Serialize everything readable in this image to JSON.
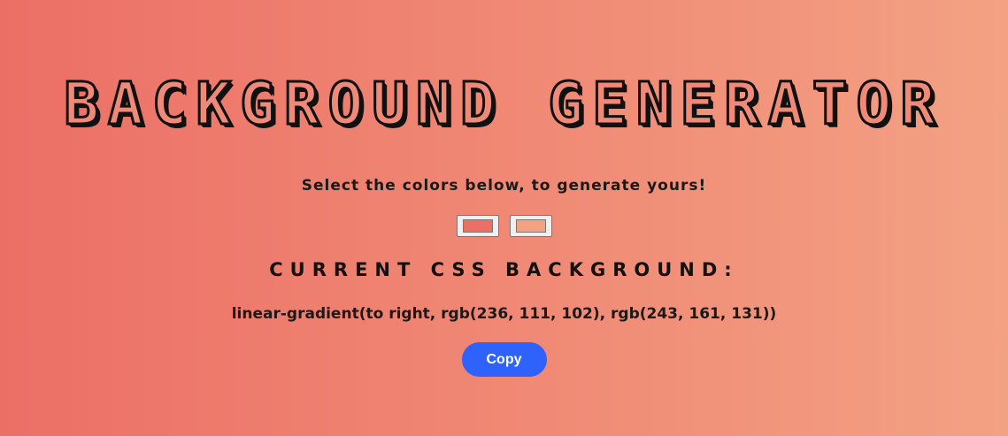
{
  "header": {
    "title": "BACKGROUND GENERATOR",
    "subtitle": "Select the colors below, to generate yours!"
  },
  "pickers": {
    "color1": "#ec6f66",
    "color2": "#f3a183"
  },
  "output": {
    "heading": "CURRENT CSS BACKGROUND:",
    "css_value": "linear-gradient(to right, rgb(236, 111, 102), rgb(243, 161, 131))"
  },
  "actions": {
    "copy_label": "Copy"
  },
  "colors": {
    "accent": "#2f62fb",
    "gradient_start": "#ec6f66",
    "gradient_end": "#f3a183"
  }
}
